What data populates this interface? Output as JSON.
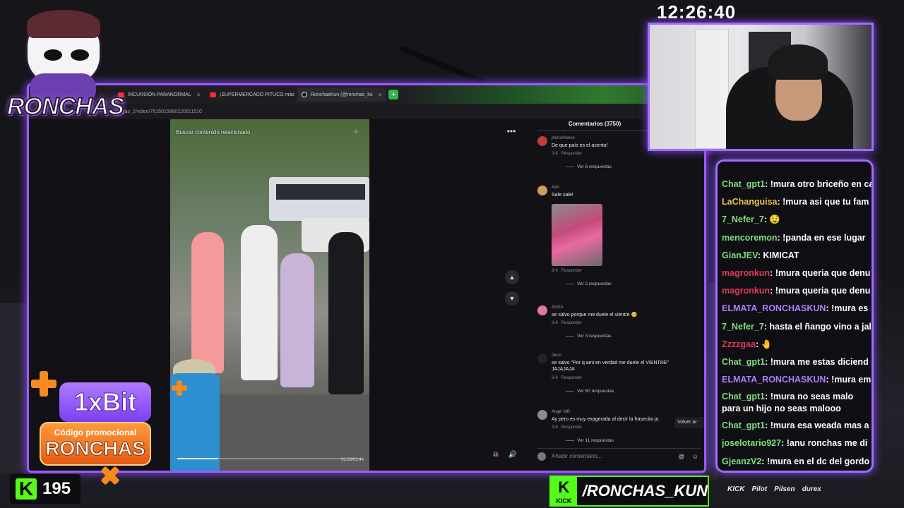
{
  "clock": "12:26:40",
  "logo": {
    "text": "RONCHAS"
  },
  "browser": {
    "tabs": [
      {
        "label": "INCURSIÓN PARANORMAL",
        "icon": "youtube-icon",
        "active": false
      },
      {
        "label": "¡SUPERMERCADO PITUCO más",
        "icon": "youtube-icon",
        "active": false
      },
      {
        "label": "RonchasKun (@ronchas_ku",
        "icon": "tiktok-icon",
        "active": true
      }
    ],
    "new_tab": "+",
    "url": "vargas_2/video/7615015880220511510"
  },
  "video": {
    "search_placeholder": "Buscar contenido relacionado",
    "time": "01:22/01:44",
    "progress": 0.22
  },
  "comments": {
    "header": "Comentarios (3750)",
    "items": [
      {
        "user": "jhonsAlonso",
        "text": "De que país es el acento!",
        "date": "3-8",
        "reply": "Responder",
        "replies": "Ver 6 respuestas",
        "avatar_color": "#c23a3a"
      },
      {
        "user": "Adri",
        "text": "Sale sale!",
        "date": "3-9",
        "reply": "Responder",
        "replies": "Ver 2 respuestas",
        "avatar_color": "#c8a060",
        "has_image": true
      },
      {
        "user": "AVOA",
        "text": "se salvo porque me duele el vientre 🥺",
        "date": "3-8",
        "reply": "Responder",
        "replies": "Ver 3 respuestas",
        "avatar_color": "#e07aa0"
      },
      {
        "user": "Jessi",
        "text": "se salvo \"Por q ami en verdad me duele el VIENTRE\" JAJAJAJA",
        "date": "3-9",
        "reply": "Responder",
        "replies": "Ver 60 respuestas",
        "avatar_color": "#222228"
      },
      {
        "user": "Ange' MB",
        "text": "Ay pero es muy exagerada al decir la frasecita ja",
        "date": "3-8",
        "reply": "Responder",
        "replies": "Ver 11 respuestas",
        "avatar_color": "#8a8a90"
      }
    ],
    "back_button": "Volver ar",
    "input_placeholder": "Añadir comentario..."
  },
  "chat": [
    {
      "user": "Chat_gpt1",
      "color": "#7fe07a",
      "message": "!mura otro briceño en ca"
    },
    {
      "user": "LaChanguisa",
      "color": "#f0c050",
      "message": "!mura asi que tu fam"
    },
    {
      "user": "7_Nefer_7",
      "color": "#7fe07a",
      "message": "🤤"
    },
    {
      "user": "mencoremon",
      "color": "#7fe07a",
      "message": "!panda en ese lugar"
    },
    {
      "user": "GianJEV",
      "color": "#7fe07a",
      "message": "KIMICAT"
    },
    {
      "user": "magronkun",
      "color": "#e03a5a",
      "message": "!mura queria que denu"
    },
    {
      "user": "magronkun",
      "color": "#e03a5a",
      "message": "!mura queria que denu"
    },
    {
      "user": "ELMATA_RONCHASKUN",
      "color": "#b07cff",
      "message": "!mura es"
    },
    {
      "user": "7_Nefer_7",
      "color": "#7fe07a",
      "message": "hasta el ñango vino a jal"
    },
    {
      "user": "Zzzzgaa",
      "color": "#e03a5a",
      "message": "🤚"
    },
    {
      "user": "Chat_gpt1",
      "color": "#7fe07a",
      "message": "!mura me estas diciend"
    },
    {
      "user": "ELMATA_RONCHASKUN",
      "color": "#b07cff",
      "message": "!mura em"
    },
    {
      "user": "Chat_gpt1",
      "color": "#7fe07a",
      "message": "!mura no seas malo para un hijo no seas malooo",
      "wrap": true
    },
    {
      "user": "Chat_gpt1",
      "color": "#7fe07a",
      "message": "!mura esa weada mas a"
    },
    {
      "user": "joselotario927",
      "color": "#7fe07a",
      "message": "!anu ronchas me di"
    },
    {
      "user": "GjeanzV2",
      "color": "#7fe07a",
      "message": "!mura en el dc del gordo"
    }
  ],
  "promo": {
    "brand": "1xBit",
    "code_label": "Código promocional",
    "code": "RONCHAS"
  },
  "viewers": {
    "count": "195",
    "icon": "kick-icon"
  },
  "channel": {
    "kick_label": "KICK",
    "name": "/RONCHAS_KUN"
  },
  "sponsors": [
    "KICK",
    "Pilot",
    "Pilsen",
    "durex"
  ],
  "colors": {
    "accent": "#9b5cf6",
    "kick_green": "#53fc18",
    "promo_orange": "#f58a1f"
  }
}
